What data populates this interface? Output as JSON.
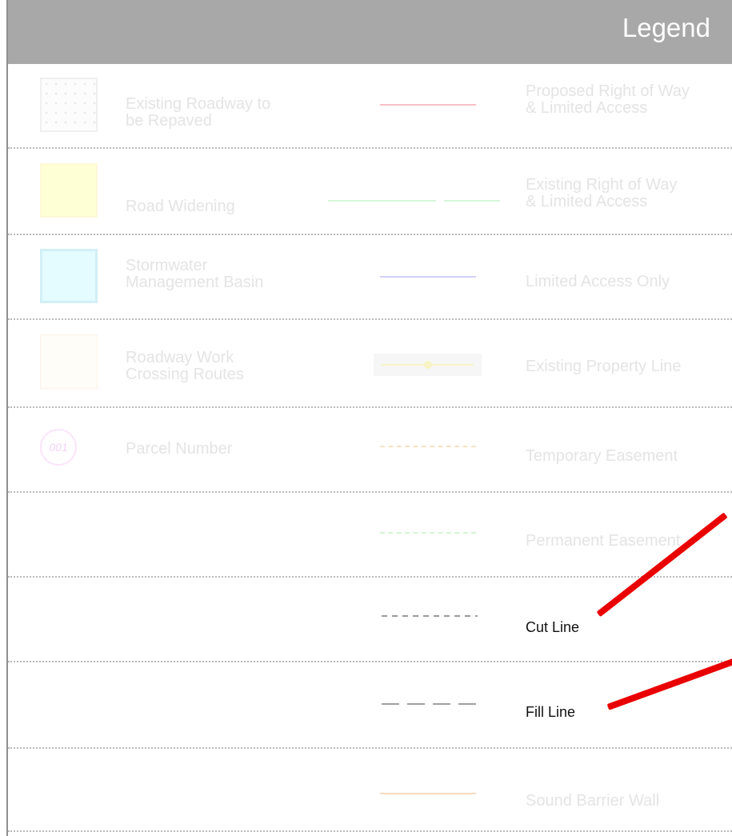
{
  "legend": {
    "title": "Legend",
    "left_items": [
      {
        "label": "Existing Roadway to\nbe Repaved",
        "icon": "dotted-square-icon"
      },
      {
        "label": "Road Widening",
        "icon": "yellow-square-icon",
        "color": "#ffffd5"
      },
      {
        "label": "Stormwater\nManagement Basin",
        "icon": "cyan-square-icon",
        "color": "#e4fbff"
      },
      {
        "label": "Roadway Work\nCrossing Routes",
        "icon": "hatched-square-icon"
      },
      {
        "label": "Parcel Number",
        "icon": "parcel-circle-icon",
        "badge": "001"
      }
    ],
    "right_items": [
      {
        "label": "Proposed Right of Way\n& Limited Access",
        "icon": "red-line-icon",
        "color": "#f7c0c8"
      },
      {
        "label": "Existing Right of Way\n& Limited Access",
        "icon": "green-line-icon",
        "color": "#d8f5d8"
      },
      {
        "label": "Limited Access Only",
        "icon": "purple-line-icon",
        "color": "#cfcff2"
      },
      {
        "label": "Existing Property Line",
        "icon": "property-line-icon",
        "color": "#f7f3c4"
      },
      {
        "label": "Temporary Easement",
        "icon": "orange-dashdot-line-icon",
        "color": "#fae0c0"
      },
      {
        "label": "Permanent Easement",
        "icon": "green-dashdot-line-icon",
        "color": "#d4f4d4"
      },
      {
        "label": "Cut Line",
        "icon": "short-dash-line-icon",
        "color": "#9a9a9a"
      },
      {
        "label": "Fill Line",
        "icon": "long-dash-line-icon",
        "color": "#a0a0a0"
      },
      {
        "label": "Sound Barrier Wall",
        "icon": "orange-line-icon",
        "color": "#fbd9c0"
      }
    ]
  },
  "annotations": {
    "arrow_color": "#e90000"
  }
}
